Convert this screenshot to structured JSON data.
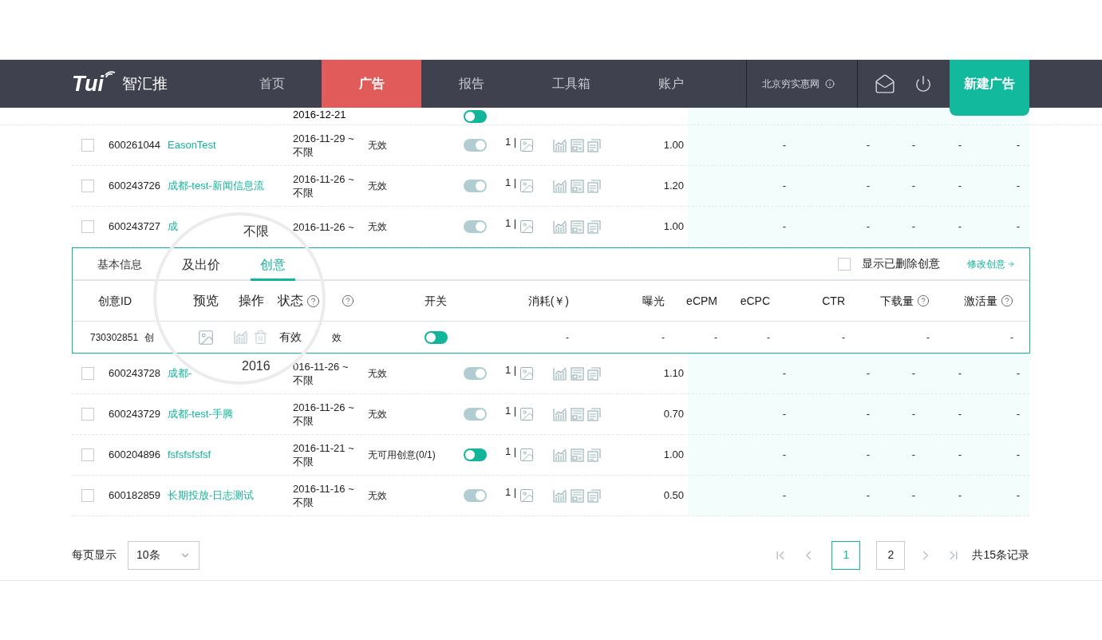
{
  "nav": {
    "logo": {
      "mark": "Tui",
      "name": "智汇推"
    },
    "items": [
      {
        "label": "首页",
        "selected": false
      },
      {
        "label": "广告",
        "selected": true
      },
      {
        "label": "报告",
        "selected": false
      },
      {
        "label": "工具箱",
        "selected": false
      },
      {
        "label": "账户",
        "selected": false
      }
    ],
    "account": "北京穷实惠网",
    "new_button": "新建广告"
  },
  "partial_row": {
    "date": "2016-12-21",
    "on": false,
    "disabled": false
  },
  "rows": [
    {
      "checked": false,
      "id": "600261044",
      "name": "EasonTest",
      "dates": [
        "2016-11-29 ~",
        "不限"
      ],
      "status": "无效",
      "on": true,
      "disabled": true,
      "count": "1 |",
      "bid": "1.00",
      "metrics": [
        "-",
        "-",
        "-",
        "-",
        "-"
      ]
    },
    {
      "checked": false,
      "id": "600243726",
      "name": "成都-test-新闻信息流",
      "dates": [
        "2016-11-26 ~",
        "不限"
      ],
      "status": "无效",
      "on": true,
      "disabled": true,
      "count": "1 |",
      "bid": "1.20",
      "metrics": [
        "-",
        "-",
        "-",
        "-",
        "-"
      ]
    },
    {
      "checked": false,
      "id": "600243727",
      "name": "成",
      "dates": [
        "2016-11-26 ~"
      ],
      "status": "无效",
      "on": true,
      "disabled": true,
      "count": "1 |",
      "bid": "1.00",
      "metrics": [
        "-",
        "-",
        "-",
        "-",
        "-"
      ]
    }
  ],
  "detail": {
    "tabs": [
      {
        "label": "基本信息",
        "selected": false
      },
      {
        "label": "及出价",
        "selected": false
      },
      {
        "label": "创意",
        "selected": true
      }
    ],
    "show_deleted": {
      "label": "显示已删除创意",
      "checked": false
    },
    "edit_link": "修改创意",
    "columns": [
      {
        "kind": "label",
        "label": "创意ID",
        "help": false
      },
      {
        "kind": "hidden"
      },
      {
        "kind": "label",
        "label": "预览",
        "help": false
      },
      {
        "kind": "label",
        "label": "操作",
        "help": false
      },
      {
        "kind": "label",
        "label": "状态",
        "help": true
      },
      {
        "kind": "help_only"
      },
      {
        "kind": "label",
        "label": "开关",
        "help": false
      },
      {
        "kind": "label",
        "label": "消耗(￥)",
        "help": false
      },
      {
        "kind": "label",
        "label": "曝光",
        "help": false
      },
      {
        "kind": "label",
        "label": "eCPM",
        "help": false
      },
      {
        "kind": "label",
        "label": "eCPC",
        "help": false
      },
      {
        "kind": "label",
        "label": "CTR",
        "help": false
      },
      {
        "kind": "label",
        "label": "下载量",
        "help": true
      },
      {
        "kind": "label",
        "label": "激活量",
        "help": true
      }
    ],
    "cells": [
      {
        "kind": "text",
        "text": "730302851"
      },
      {
        "kind": "text",
        "text": "创"
      },
      {
        "kind": "preview"
      },
      {
        "kind": "ops"
      },
      {
        "kind": "text",
        "text": "有效"
      },
      {
        "kind": "text",
        "text": "效"
      },
      {
        "kind": "switch",
        "on": false,
        "disabled": false
      },
      {
        "kind": "text",
        "text": "-"
      },
      {
        "kind": "text",
        "text": "-"
      },
      {
        "kind": "text",
        "text": "-"
      },
      {
        "kind": "text",
        "text": "-"
      },
      {
        "kind": "text",
        "text": "-"
      },
      {
        "kind": "text",
        "text": "-"
      },
      {
        "kind": "text",
        "text": "-"
      }
    ]
  },
  "more_rows": [
    {
      "checked": false,
      "id": "600243728",
      "name": "成都-",
      "dates": [
        "016-11-26 ~",
        "不限"
      ],
      "status": "无效",
      "on": true,
      "disabled": true,
      "count": "1 |",
      "bid": "1.10",
      "metrics": [
        "-",
        "-",
        "-",
        "-",
        "-"
      ]
    },
    {
      "checked": false,
      "id": "600243729",
      "name": "成都-test-手腾",
      "dates": [
        "2016-11-26 ~",
        "不限"
      ],
      "status": "无效",
      "on": true,
      "disabled": true,
      "count": "1 |",
      "bid": "0.70",
      "metrics": [
        "-",
        "-",
        "-",
        "-",
        "-"
      ]
    },
    {
      "checked": false,
      "id": "600204896",
      "name": "fsfsfsfsfsf",
      "dates": [
        "2016-11-21 ~",
        "不限"
      ],
      "status": "无可用创意(0/1)",
      "on": false,
      "disabled": false,
      "count": "1 |",
      "bid": "1.00",
      "metrics": [
        "-",
        "-",
        "-",
        "-",
        "-"
      ]
    },
    {
      "checked": false,
      "id": "600182859",
      "name": "长期投放-日志测试",
      "dates": [
        "2016-11-16 ~",
        "不限"
      ],
      "status": "无效",
      "on": true,
      "disabled": true,
      "count": "1 |",
      "bid": "0.50",
      "metrics": [
        "-",
        "-",
        "-",
        "-",
        "-"
      ]
    }
  ],
  "lens": {
    "texts": [
      "不限",
      "2016"
    ]
  },
  "pager": {
    "per_page_label": "每页显示",
    "per_page": "10条",
    "pages": [
      {
        "label": "1",
        "selected": true
      },
      {
        "label": "2",
        "selected": false
      }
    ],
    "total": "共15条记录"
  }
}
